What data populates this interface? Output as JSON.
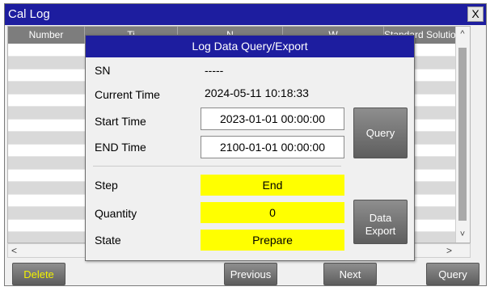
{
  "window": {
    "title": "Cal Log",
    "close_label": "X"
  },
  "table": {
    "columns": [
      "Number",
      "Ti",
      "N",
      "W",
      "Standard Solution"
    ],
    "row_count": 16
  },
  "dialog": {
    "title": "Log Data Query/Export",
    "sn_label": "SN",
    "sn_value": "-----",
    "current_time_label": "Current Time",
    "current_time_value": "2024-05-11 10:18:33",
    "start_time_label": "Start Time",
    "start_time_value": "2023-01-01 00:00:00",
    "end_time_label": "END Time",
    "end_time_value": "2100-01-01 00:00:00",
    "step_label": "Step",
    "step_value": "End",
    "quantity_label": "Quantity",
    "quantity_value": "0",
    "state_label": "State",
    "state_value": "Prepare",
    "query_button": "Query",
    "export_button_line1": "Data",
    "export_button_line2": "Export"
  },
  "buttons": {
    "delete": "Delete",
    "previous": "Previous",
    "next": "Next",
    "query": "Query"
  },
  "scroll": {
    "up": "^",
    "down": "˅",
    "left": "<",
    "right": ">"
  },
  "colors": {
    "title_bar": "#1d1d9f",
    "highlight_field": "#ffff00",
    "delete_text": "#f2f200"
  }
}
